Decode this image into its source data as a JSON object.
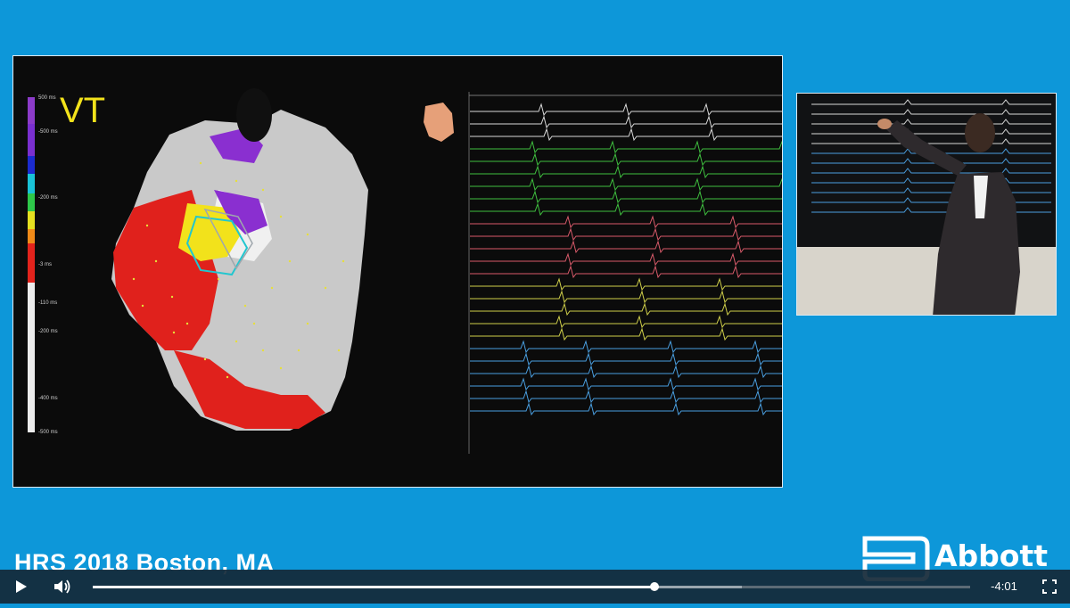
{
  "video": {
    "overlay_label": "VT",
    "conference_text": "HRS 2018 Boston, MA",
    "brand_text": "Abbott",
    "time_remaining": "-4:01",
    "progress": 0.64,
    "buffered": 0.74
  },
  "colorbar_labels": [
    "500 ms",
    "-500 ms",
    "-200 ms",
    "-3 ms",
    "-110 ms",
    "-200 ms",
    "-400 ms",
    "-500 ms"
  ],
  "colors": {
    "background": "#0d97d9",
    "control_bar": "#14283a",
    "ecg_trace": "#d9d9d9",
    "green_trace": "#3fbf3f",
    "red_trace": "#d85a6a",
    "yellow_trace": "#cfcf4a",
    "blue_trace": "#4a9fe0"
  },
  "icons": {
    "play": "play-icon",
    "volume": "volume-icon",
    "fullscreen": "fullscreen-icon"
  }
}
